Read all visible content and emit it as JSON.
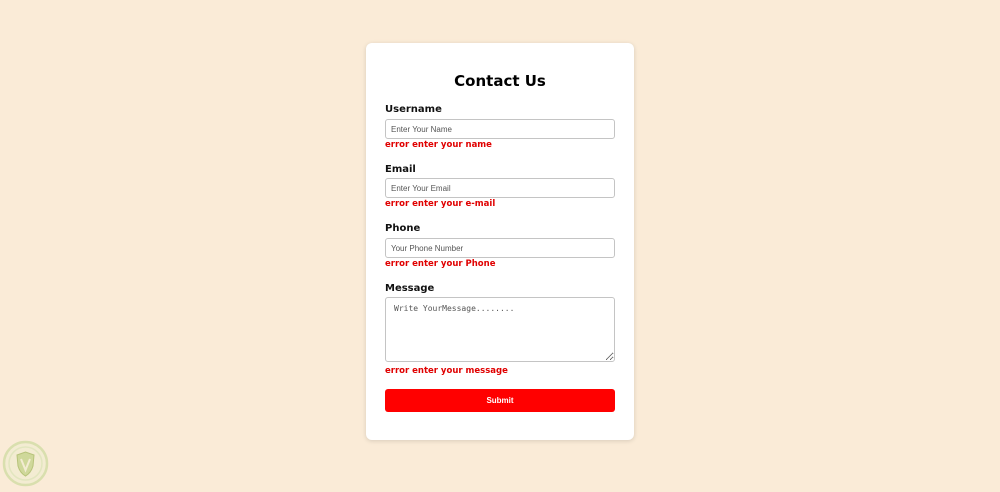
{
  "form": {
    "title": "Contact Us",
    "fields": {
      "username": {
        "label": "Username",
        "placeholder": "Enter Your Name",
        "error": "error enter your name"
      },
      "email": {
        "label": "Email",
        "placeholder": "Enter Your Email",
        "error": "error enter your e-mail"
      },
      "phone": {
        "label": "Phone",
        "placeholder": "Your Phone Number",
        "error": "error enter your Phone"
      },
      "message": {
        "label": "Message",
        "placeholder": "Write YourMessage........",
        "error": "error enter your message"
      }
    },
    "submit_label": "Submit"
  },
  "badge": {
    "icon": "shield-logo-icon"
  },
  "colors": {
    "background": "#faebd7",
    "card": "#ffffff",
    "error": "#e00000",
    "submit": "#ff0000"
  }
}
